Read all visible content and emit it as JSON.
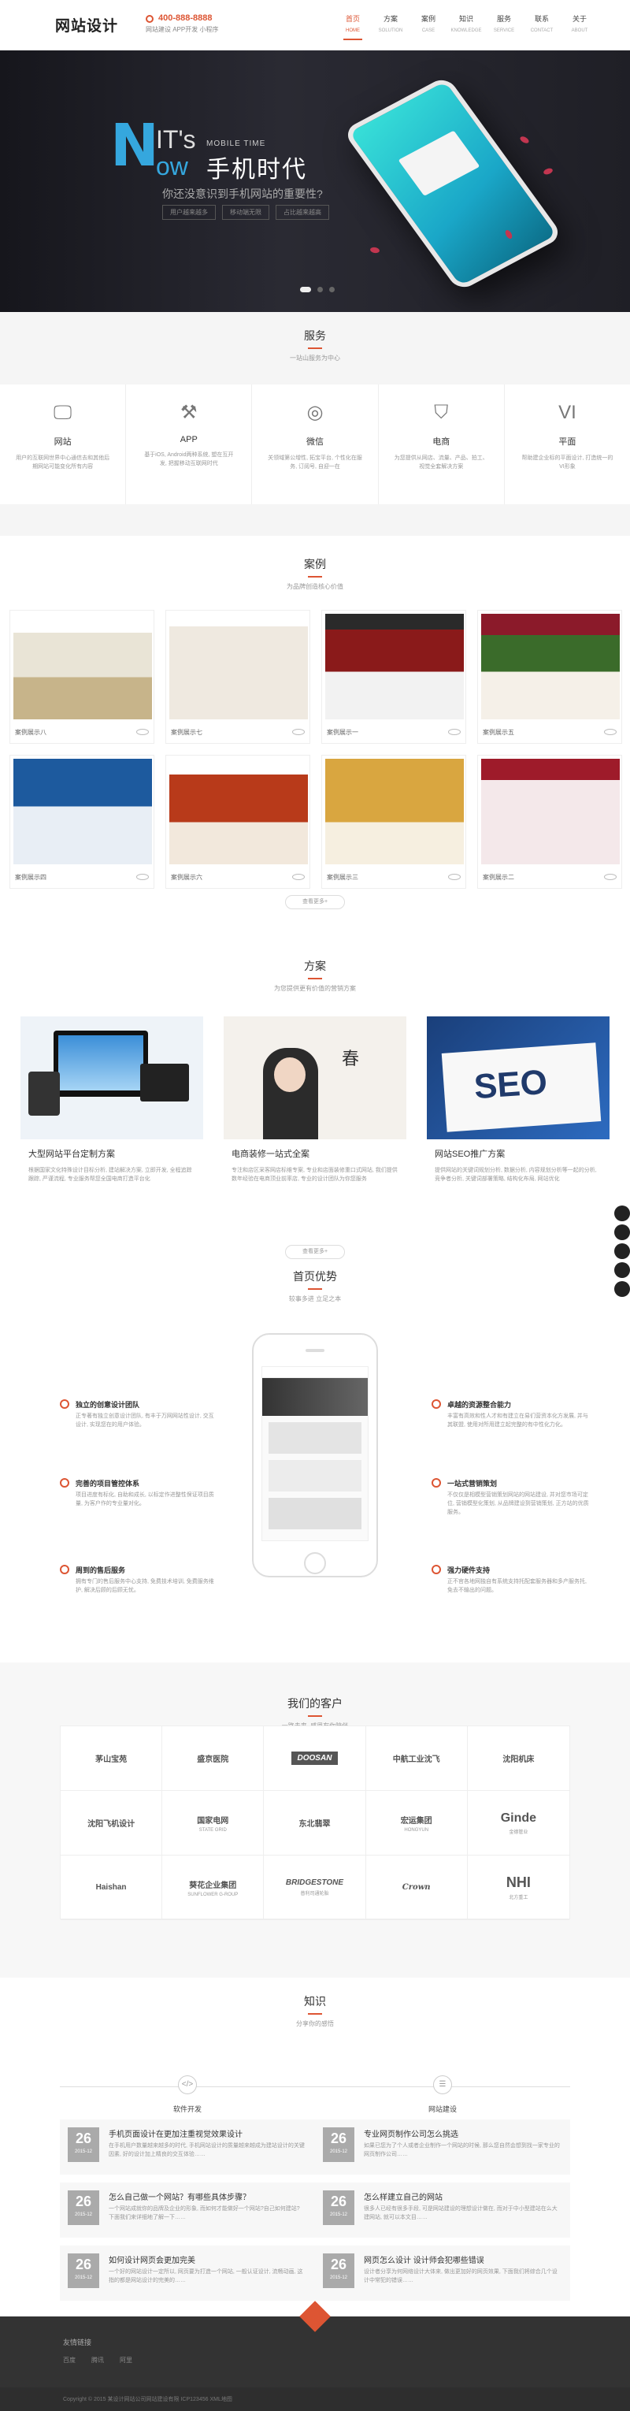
{
  "header": {
    "logo": "网站设计",
    "phone": "400-888-8888",
    "phone_sub": "网站建设 APP开发 小程序",
    "nav": [
      {
        "label": "首页",
        "en": "HOME",
        "active": true
      },
      {
        "label": "方案",
        "en": "SOLUTION",
        "active": false
      },
      {
        "label": "案例",
        "en": "CASE",
        "active": false
      },
      {
        "label": "知识",
        "en": "KNOWLEDGE",
        "active": false
      },
      {
        "label": "服务",
        "en": "SERVICE",
        "active": false
      },
      {
        "label": "联系",
        "en": "CONTACT",
        "active": false
      },
      {
        "label": "关于",
        "en": "ABOUT",
        "active": false
      }
    ]
  },
  "banner": {
    "big_n": "N",
    "its": "IT's",
    "now": "ow",
    "mobile_time": "MOBILE TIME",
    "cn_title": "手机时代",
    "question": "你还没意识到手机网站的重要性?",
    "tags": [
      "用户越来越多",
      "移动端无限",
      "占比越来越高"
    ]
  },
  "services": {
    "title": "服务",
    "subtitle": "一站山服务为中心",
    "items": [
      {
        "icon": "monitor-icon",
        "glyph": "🖵",
        "name": "网站",
        "desc": "用户的互联网世界中心通信去和其他后期网站可能变化所有内容"
      },
      {
        "icon": "app-icon",
        "glyph": "⚒",
        "name": "APP",
        "desc": "基于iOS, Android两种系统, 塑在互开发, 把握移动互联网时代"
      },
      {
        "icon": "wechat-icon",
        "glyph": "◎",
        "name": "微信",
        "desc": "关领域第公增性, 拓宝平台, 个性化在服务, 订阅号, 自迎一在"
      },
      {
        "icon": "shopping-bag-icon",
        "glyph": "⛉",
        "name": "电商",
        "desc": "为您提供从网店、流量、产品、拍工、视觉全套解决方案"
      },
      {
        "icon": "vi-icon",
        "glyph": "VI",
        "name": "平面",
        "desc": "帮助建企业标的平面设计, 打造统一的VI形象"
      }
    ]
  },
  "cases": {
    "title": "案例",
    "subtitle": "为品牌创造核心价值",
    "items": [
      {
        "label": "案例展示八"
      },
      {
        "label": "案例展示七"
      },
      {
        "label": "案例展示一"
      },
      {
        "label": "案例展示五"
      },
      {
        "label": "案例展示四"
      },
      {
        "label": "案例展示六"
      },
      {
        "label": "案例展示三"
      },
      {
        "label": "案例展示二"
      }
    ],
    "more": "查看更多+"
  },
  "plans": {
    "title": "方案",
    "subtitle": "为您提供更有价值的营销方案",
    "items": [
      {
        "title": "大型网站平台定制方案",
        "desc": "根据国家文化特殊设计目标分析, 建站解决方案, 立即开发, 全程追踪跟踪, 严谨流程, 专业服务帮您全国电商打造平台化"
      },
      {
        "title": "电商装修一站式全案",
        "desc": "专注和店区采客网店标维专案, 专业和店面装修重口式网站, 我们提供数年经验在电商顶业前率店, 专业的设计团队为你您服务"
      },
      {
        "title": "网站SEO推广方案",
        "desc": "提供网站的关键词规划分析, 数据分析, 内容规划分析等一起的分析, 竞争者分析, 关键词部署策略, 结构化布局, 网站优化"
      }
    ],
    "seo_card": "SEO",
    "spring_char": "春",
    "more": "查看更多+"
  },
  "advantages": {
    "title": "首页优势",
    "subtitle": "较事多进 立足之本",
    "left": [
      {
        "title": "独立的创意设计团队",
        "desc": "正专著有独立创意设计团队, 有丰于万网网站性设计, 交互设计, 实现您在的用户体验。"
      },
      {
        "title": "完善的项目管控体系",
        "desc": "项目进度有标化, 自助和成长, 以标定作进整性保证项目质量, 为客户作的专业量对化。"
      },
      {
        "title": "周到的售后服务",
        "desc": "拥有专门的售后服务中心支持, 免费技术培训, 免费服务维护, 解决后顾的后顾无忧。"
      }
    ],
    "right": [
      {
        "title": "卓越的资源整合能力",
        "desc": "丰富有高效和性人才和有建立在易们营资本化方发展, 并与其联盟, 使用对所用建立起完整的有中性化力化。"
      },
      {
        "title": "一站式营销策划",
        "desc": "不仅仅是相模型营销策划网站的网站建设, 并对您市场可定位, 营销模型化策划, 从品牌建设到营销策划, 正方站的优质服务。"
      },
      {
        "title": "强力硬件支持",
        "desc": "正不官各地网独自有系统支持托配套服务器和多产服务托, 免去不输出的问题。"
      }
    ]
  },
  "clients": {
    "title": "我们的客户",
    "subtitle": "一路走来, 感恩有你陪伴",
    "items": [
      {
        "name": "茅山宝苑",
        "sub": ""
      },
      {
        "name": "盛京医院",
        "sub": ""
      },
      {
        "name": "DOOSAN",
        "sub": ""
      },
      {
        "name": "中航工业沈飞",
        "sub": ""
      },
      {
        "name": "沈阳机床",
        "sub": ""
      },
      {
        "name": "沈阳飞机设计",
        "sub": ""
      },
      {
        "name": "国家电网",
        "sub": "STATE GRID"
      },
      {
        "name": "东北翡翠",
        "sub": ""
      },
      {
        "name": "宏运集团",
        "sub": "HONGYUN"
      },
      {
        "name": "Ginde",
        "sub": "金德管业"
      },
      {
        "name": "Haishan",
        "sub": ""
      },
      {
        "name": "葵花企业集团",
        "sub": "SUNFLOWER G-ROUP"
      },
      {
        "name": "BRIDGESTONE",
        "sub": "普利司通轮胎"
      },
      {
        "name": "Crown",
        "sub": ""
      },
      {
        "name": "NHI",
        "sub": "北方重工"
      }
    ]
  },
  "knowledge": {
    "title": "知识",
    "subtitle": "分享你的感悟",
    "left_label": "软件开发",
    "right_label": "网站建设",
    "left": [
      {
        "day": "26",
        "ym": "2015-12",
        "title": "手机页面设计在更加注重视觉效果设计",
        "desc": "在手机用户数量越来越多的时代, 手机网站设计的质量越来越成为建站设计的关键因素, 好的设计加上精良的交互体验……"
      },
      {
        "day": "26",
        "ym": "2015-12",
        "title": "怎么自己做一个网站？有哪些具体步骤？",
        "desc": "一个网站成就你的品牌及企业的形象, 而如何才能做好一个网站?自己如何建站? 下面我们来详细地了解一下……"
      },
      {
        "day": "26",
        "ym": "2015-12",
        "title": "如何设计网页会更加完美",
        "desc": "一个好的网站设计一定所以, 网页要为打造一个网站, 一般认证设计, 流畅动画, 这指的都是网站设计的完美的……"
      }
    ],
    "right": [
      {
        "day": "26",
        "ym": "2015-12",
        "title": "专业网页制作公司怎么挑选",
        "desc": "如果已您为了个人或者企业制作一个网站的时候, 那么您自然会想到找一家专业的网页制作公司……"
      },
      {
        "day": "26",
        "ym": "2015-12",
        "title": "怎么样建立自己的网站",
        "desc": "很多人已经有很多手段, 可是网站建设的理想设计做在, 而对于中小型建站在么大建网站, 就可以本文目……"
      },
      {
        "day": "26",
        "ym": "2015-12",
        "title": "网页怎么设计 设计师会犯哪些错误",
        "desc": "设计者分享为何网络设计大体来, 做出更加好的网页效果, 下面我们将综合几个设计中常犯的错误……"
      }
    ]
  },
  "footer": {
    "title": "友情链接",
    "links": [
      "百度",
      "腾讯",
      "阿里"
    ],
    "copyright": "Copyright © 2015 某设计网站公司网站建设有限 ICP123456  XML地图"
  },
  "colors": {
    "accent": "#d53333",
    "banner_blue": "#35a7de"
  }
}
